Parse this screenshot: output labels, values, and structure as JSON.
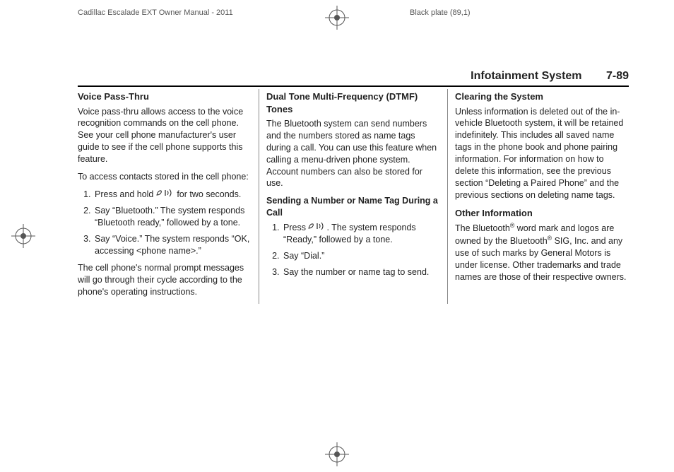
{
  "meta": {
    "doc_title": "Cadillac Escalade EXT Owner Manual - 2011",
    "plate": "Black plate (89,1)"
  },
  "header": {
    "section": "Infotainment System",
    "page": "7-89"
  },
  "col1": {
    "h1": "Voice Pass-Thru",
    "p1": "Voice pass-thru allows access to the voice recognition commands on the cell phone. See your cell phone manufacturer's user guide to see if the cell phone supports this feature.",
    "p2": "To access contacts stored in the cell phone:",
    "li1a": "Press and hold ",
    "li1b": " for two seconds.",
    "li2": "Say “Bluetooth.” The system responds “Bluetooth ready,” followed by a tone.",
    "li3": "Say “Voice.” The system responds “OK, accessing <phone name>.”",
    "p3": "The cell phone's normal prompt messages will go through their cycle according to the phone's operating instructions."
  },
  "col2": {
    "h1": "Dual Tone Multi-Frequency (DTMF) Tones",
    "p1": "The Bluetooth system can send numbers and the numbers stored as name tags during a call. You can use this feature when calling a menu-driven phone system. Account numbers can also be stored for use.",
    "sub1": "Sending a Number or Name Tag During a Call",
    "li1a": "Press ",
    "li1b": ". The system responds “Ready,” followed by a tone.",
    "li2": "Say “Dial.”",
    "li3": "Say the number or name tag to send."
  },
  "col3": {
    "h1": "Clearing the System",
    "p1": "Unless information is deleted out of the in-vehicle Bluetooth system, it will be retained indefinitely. This includes all saved name tags in the phone book and phone pairing information. For information on how to delete this information, see the previous section “Deleting a Paired Phone” and the previous sections on deleting name tags.",
    "h2": "Other Information",
    "p2a": "The Bluetooth",
    "p2b": " word mark and logos are owned by the Bluetooth",
    "p2c": " SIG, Inc. and any use of such marks by General Motors is under license. Other trademarks and trade names are those of their respective owners."
  }
}
